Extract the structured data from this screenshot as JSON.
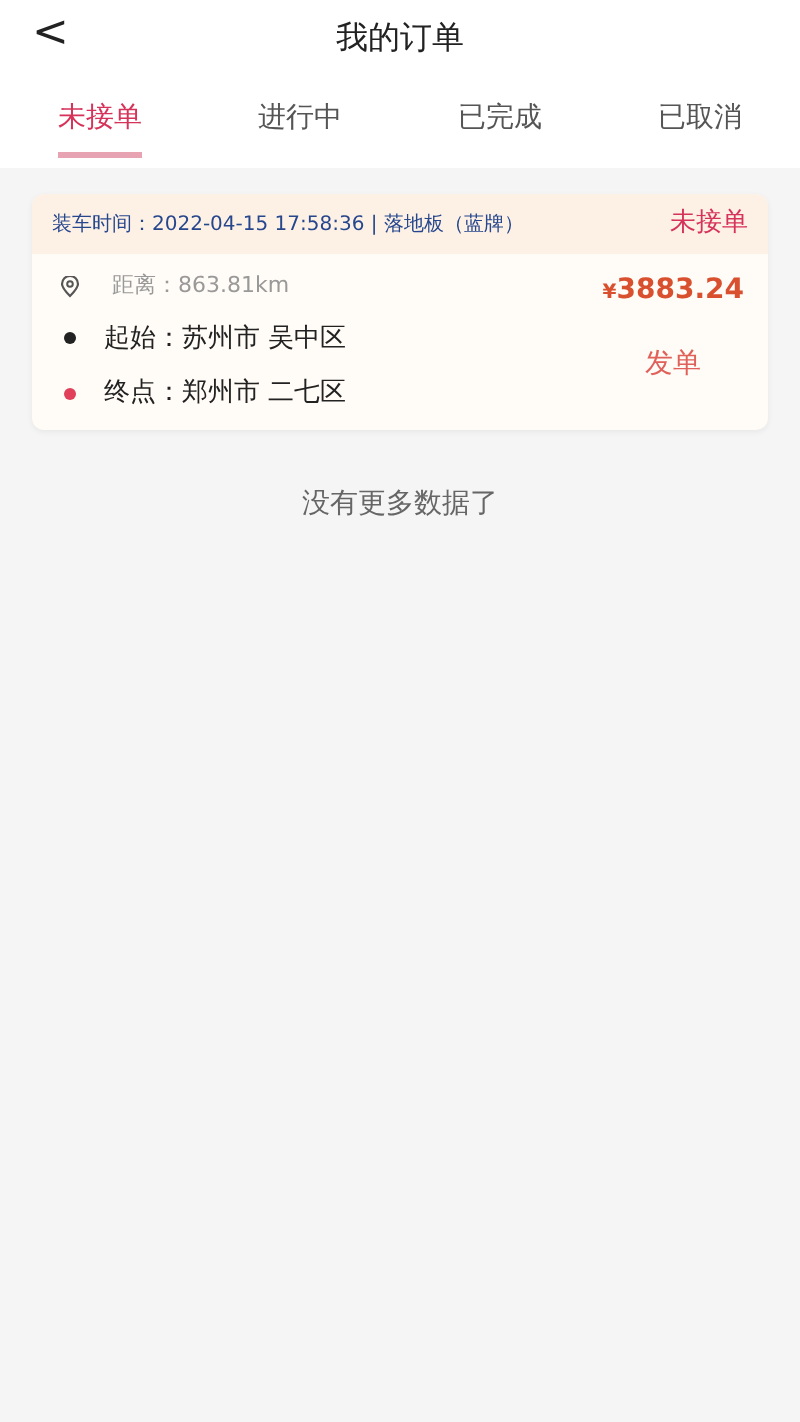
{
  "header": {
    "back": "<",
    "title": "我的订单"
  },
  "tabs": [
    {
      "label": "未接单",
      "selected": true
    },
    {
      "label": "进行中",
      "selected": false
    },
    {
      "label": "已完成",
      "selected": false
    },
    {
      "label": "已取消",
      "selected": false
    }
  ],
  "orders": [
    {
      "load_info": "装车时间：2022-04-15 17:58:36 | 落地板（蓝牌）",
      "status": "未接单",
      "distance": "距离：863.81km",
      "currency": "¥",
      "price": "3883.24",
      "action": "发单",
      "stops": [
        {
          "label": "起始：苏州市 吴中区",
          "color": "#222222"
        },
        {
          "label": "终点：郑州市 二七区",
          "color": "#e0405a"
        }
      ]
    }
  ],
  "end_text": "没有更多数据了"
}
